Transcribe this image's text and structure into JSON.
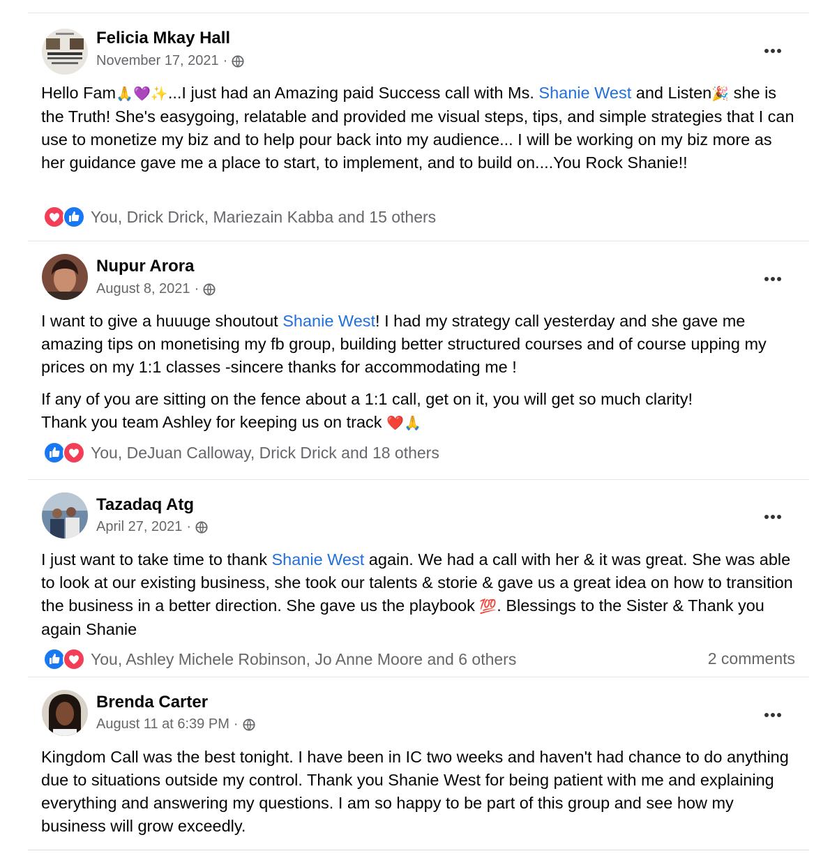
{
  "posts": [
    {
      "author": "Felicia Mkay Hall",
      "date": "November 17, 2021",
      "dot": "·",
      "text_a": "Hello Fam",
      "emoji_a": "🙏💜✨",
      "text_b": "...I just had an Amazing paid Success call with Ms. ",
      "mention": "Shanie West",
      "text_c": " and Listen",
      "emoji_b": "🎉",
      "text_d": " she is the Truth! She's easygoing, relatable and provided me visual steps, tips, and simple strategies that I can use to monetize my biz and to help pour back into my audience... I will be working on my biz more as her guidance gave me a place to start, to implement, and to build on....You Rock Shanie!!",
      "reactions": "You, Drick Drick, Mariezain Kabba and 15 others"
    },
    {
      "author": "Nupur Arora",
      "date": "August 8, 2021",
      "dot": "·",
      "text_a": "I want to give a huuuge shoutout ",
      "mention": "Shanie West",
      "text_b": "! I had my strategy call yesterday and she gave me amazing tips on monetising my fb group, building better structured courses and of course upping my prices on my 1:1 classes -sincere thanks for accommodating me !",
      "para2": "If any of you are sitting on the fence about a 1:1 call, get on it, you will get so much clarity!",
      "para3": "Thank you team Ashley for keeping us on track ",
      "emoji_a": "❤️🙏",
      "reactions": "You, DeJuan Calloway, Drick Drick and 18 others"
    },
    {
      "author": "Tazadaq Atg",
      "date": "April 27, 2021",
      "dot": "·",
      "text_a": "I just want to take time to thank ",
      "mention": "Shanie West",
      "text_b": " again. We had a call with her & it was great. She was able to look at our existing business, she took our talents & storie & gave us a great idea on how to transition the business in a better direction. She gave us the playbook ",
      "emoji_a": "💯",
      "text_c": ".  Blessings to the Sister & Thank you again Shanie",
      "reactions": "You, Ashley Michele Robinson, Jo Anne Moore and 6 others",
      "comments": "2 comments"
    },
    {
      "author": "Brenda Carter",
      "date": "August 11 at 6:39 PM",
      "dot": "·",
      "text_a": "Kingdom Call was the best tonight. I have been in IC two weeks and haven't had chance to do anything due to  situations outside my control. Thank you Shanie West for being patient with me and explaining everything and answering my questions. I am so happy to be part of this group and see how my business will grow exceedly."
    }
  ],
  "colors": {
    "link": "#216fdb",
    "like": "#1877f2",
    "love": "#f33e58",
    "meta": "#65676b"
  },
  "icons": {
    "like": "like-reaction-icon",
    "love": "love-reaction-icon",
    "globe": "globe-icon",
    "more": "more-options-icon"
  }
}
